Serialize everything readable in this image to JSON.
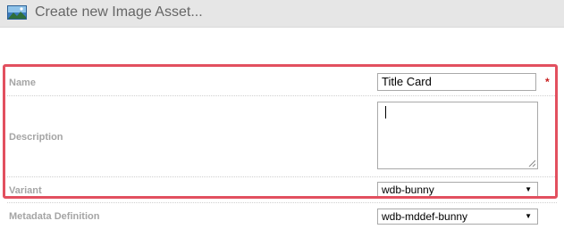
{
  "header": {
    "title": "Create new Image Asset...",
    "icon": "landscape-image-icon"
  },
  "form": {
    "name": {
      "label": "Name",
      "value": "Title Card",
      "required_marker": "*"
    },
    "description": {
      "label": "Description",
      "value": ""
    },
    "variant": {
      "label": "Variant",
      "selected": "wdb-bunny"
    },
    "metadata_definition": {
      "label": "Metadata Definition",
      "selected": "wdb-mddef-bunny"
    }
  },
  "colors": {
    "highlight_border": "#e2505f",
    "label_text": "#a5a5a5",
    "required": "#c81e1e",
    "header_bg": "#e6e6e6"
  }
}
